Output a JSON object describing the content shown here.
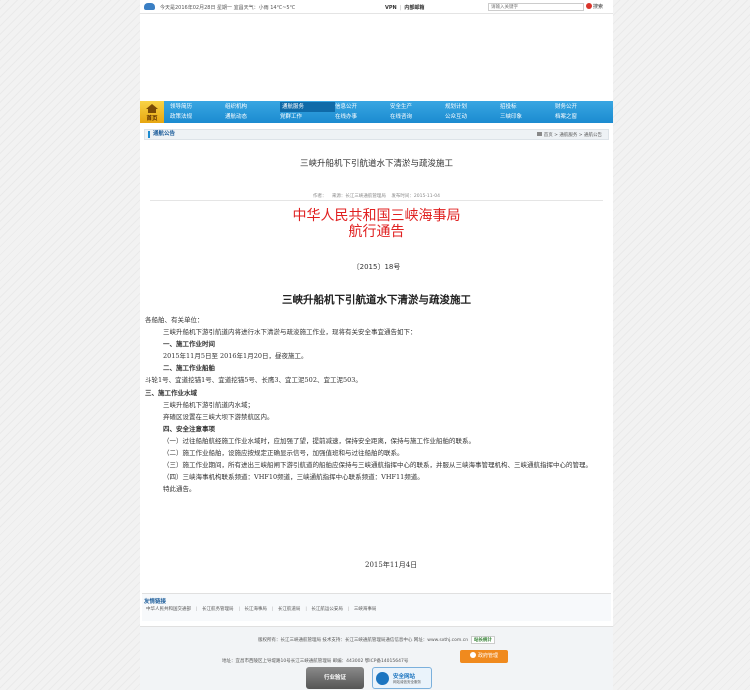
{
  "topbar": {
    "date_weather": "今天是2016年02月28日 星期一  宜昌天气：小雨 14℃~5℃",
    "link1": "VPN",
    "link2": "内部邮箱",
    "search_placeholder": "请输入关键字",
    "search_label": "搜索"
  },
  "nav": {
    "home_label": "首页",
    "row1": [
      "领导简历",
      "组织机构",
      "通航服务",
      "信息公开",
      "安全生产",
      "规划计划",
      "招投标",
      "财务公开"
    ],
    "row2": [
      "政策法规",
      "通航动态",
      "党群工作",
      "在线办事",
      "在线咨询",
      "公众互动",
      "三峡印象",
      "档案之窗"
    ]
  },
  "breadcrumb": {
    "title": "通航公告",
    "path": "首页 > 通航服务 > 通航公告"
  },
  "article": {
    "title": "三峡升船机下引航道水下清淤与疏浚施工",
    "meta_author": "作者：",
    "meta_source": "来源：长江三峡通航管理局",
    "meta_time": "发布时间：2015-11-04",
    "org_line1": "中华人民共和国三峡海事局",
    "org_line2": "航行通告",
    "doc_no": "〔2015〕18号",
    "heading": "三峡升船机下引航道水下清淤与疏浚施工",
    "p1": "各船舶、有关单位：",
    "p2": "三峡升船机下游引航道内将进行水下清淤与疏浚施工作业，现将有关安全事宜通告如下：",
    "s1": "一、施工作业时间",
    "p3": "2015年11月5日至 2016年1月20日，昼夜施工。",
    "s2": "二、施工作业船舶",
    "p4": "斗轮1号、宜道挖锚1号、宜道挖锚5号、长鹰3、宜工泥502、宜工泥503。",
    "s3": "三、施工作业水域",
    "p5": "三峡升船机下游引航道内水域；",
    "p6": "弃碴区设置在三峡大坝下游禁航区内。",
    "s4": "四、安全注意事项",
    "p7": "（一）过往船舶航经施工作业水域时，应加强了望，提前减速，保持安全距离，保持与施工作业船舶的联系。",
    "p8": "（二）施工作业船舶，设施应按规定正确显示信号，加强值班和与过往船舶的联系。",
    "p9": "（三）施工作业期间，所有进出三峡船闸下游引航道的船舶应保持与三峡通航指挥中心的联系，并服从三峡海事管理机构、三峡通航指挥中心的管理。",
    "p10": "（四）三峡海事机构联系频道：VHF10频道，三峡通航指挥中心联系频道：VHF11频道。",
    "p11": "特此通告。",
    "sign_date": "2015年11月4日"
  },
  "links": {
    "title": "友情链接",
    "items": [
      "中华人民共和国交通部",
      "长江航务管理局",
      "长江海事局",
      "长江航道局",
      "长江航运公安局",
      "三峡海事局"
    ]
  },
  "footer": {
    "line1": "版权所有：长江三峡通航管理局  技术支持：长江三峡通航管理局通信信息中心  网址：www.sxthj.com.cn",
    "stat": "站长统计",
    "line2": "地址：宜昌市西陵区上导堤路10号长江三峡通航管理局  邮编：443002  鄂ICP备14015647号",
    "gov_label": "政府管理",
    "badge1": "行业验证",
    "badge2_title": "安全网站",
    "badge2_sub": "网站诚信安全服务"
  }
}
